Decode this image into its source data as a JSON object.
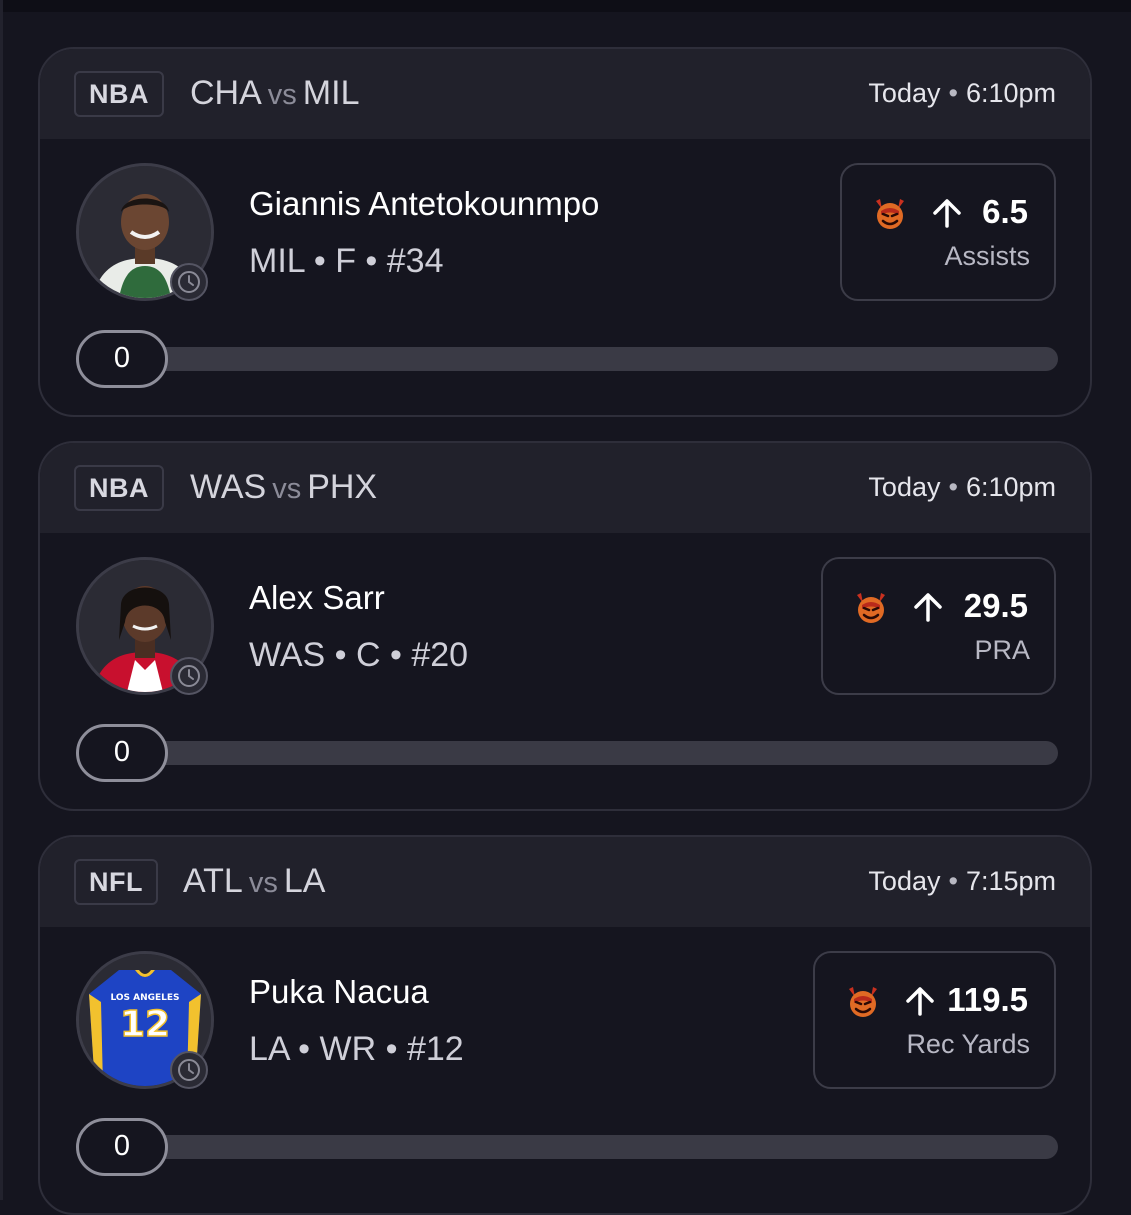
{
  "picks": [
    {
      "league": "NBA",
      "away_team": "CHA",
      "vs_label": "vs",
      "home_team": "MIL",
      "day": "Today",
      "time": "6:10pm",
      "player_name": "Giannis Antetokounmpo",
      "player_meta": "MIL • F • #34",
      "line": "6.5",
      "stat": "Assists",
      "progress_value": "0",
      "progress_fraction": 0,
      "jersey_color": "#1f4d2e"
    },
    {
      "league": "NBA",
      "away_team": "WAS",
      "vs_label": "vs",
      "home_team": "PHX",
      "day": "Today",
      "time": "6:10pm",
      "player_name": "Alex Sarr",
      "player_meta": "WAS • C • #20",
      "line": "29.5",
      "stat": "PRA",
      "progress_value": "0",
      "progress_fraction": 0,
      "jersey_color": "#c8102e"
    },
    {
      "league": "NFL",
      "away_team": "ATL",
      "vs_label": "vs",
      "home_team": "LA",
      "day": "Today",
      "time": "7:15pm",
      "player_name": "Puka Nacua",
      "player_meta": "LA • WR • #12",
      "line": "119.5",
      "stat": "Rec Yards",
      "progress_value": "0",
      "progress_fraction": 0,
      "jersey_color": "#1e44c4",
      "jersey_text": "LOS ANGELES",
      "jersey_number": "12"
    }
  ],
  "colors": {
    "background": "#15151f",
    "card_header": "#21212b",
    "card_border": "#2e2e3a",
    "demon": "#d23c2a"
  },
  "icons": {
    "pick_type": "demon-icon",
    "direction": "arrow-up-icon",
    "status": "clock-icon"
  }
}
